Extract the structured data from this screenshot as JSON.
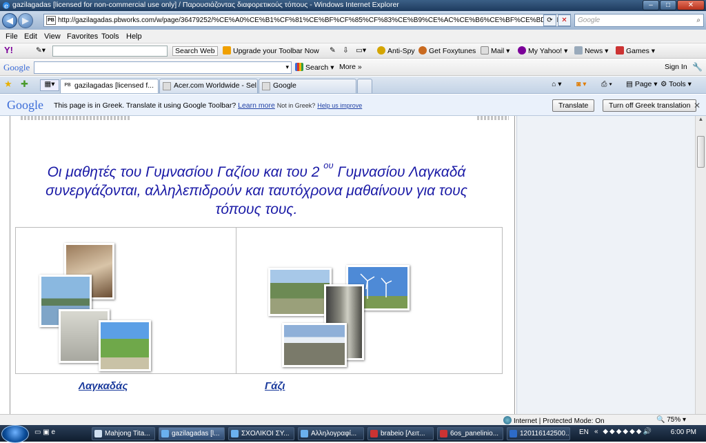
{
  "window": {
    "title": "gazilagadas [licensed for non-commercial use only] / Παρουσιάζοντας διαφορετικούς τόπους - Windows Internet Explorer"
  },
  "address": {
    "url": "http://gazilagadas.pbworks.com/w/page/36479252/%CE%A0%CE%B1%CF%81%CE%BF%CF%85%CF%83%CE%B9%CE%AC%CE%B6%CE%BF%CE%BD%CF%84%C",
    "search_placeholder": "Google"
  },
  "menu": [
    "File",
    "Edit",
    "View",
    "Favorites",
    "Tools",
    "Help"
  ],
  "yahoo": {
    "search_web": "Search Web",
    "upgrade": "Upgrade your Toolbar Now",
    "antispy": "Anti-Spy",
    "foxytunes": "Get Foxytunes",
    "mail": "Mail",
    "myyahoo": "My Yahoo!",
    "news": "News",
    "games": "Games"
  },
  "googlebar": {
    "logo": "Google",
    "search": "Search",
    "more": "More »",
    "signin": "Sign In"
  },
  "tabs": [
    {
      "label": "gazilagadas [licensed f...",
      "icon": "PB"
    },
    {
      "label": "Acer.com Worldwide - Sel..."
    },
    {
      "label": "Google"
    }
  ],
  "commandbar": {
    "page": "Page",
    "tools": "Tools"
  },
  "translate": {
    "logo": "Google",
    "message": "This page is in Greek.  Translate it using Google Toolbar?",
    "learn_more": "Learn more",
    "not_greek": "Not in Greek?",
    "help_improve": "Help us improve",
    "translate_btn": "Translate",
    "turn_off_btn": "Turn off Greek translation"
  },
  "content": {
    "headline_part1": "Οι μαθητές του Γυμνασίου Γαζίου και του 2",
    "headline_sup": "ου",
    "headline_part2": "Γυμνασίου Λαγκαδά",
    "headline_line2": "συνεργάζονται, αλληλεπιδρούν και ταυτόχρονα μαθαίνουν για τους",
    "headline_line3": "τόπους τους.",
    "place_left": "Λαγκαδάς",
    "place_right": "Γάζι"
  },
  "status": {
    "zone": "Internet | Protected Mode: On",
    "zoom": "75%"
  },
  "taskbar": {
    "items": [
      "Mahjong Tita...",
      "gazilagadas [l...",
      "ΣΧΟΛΙΚΟΙ ΣΥ...",
      "Αλληλογραφί...",
      "brabeio [Λειτ...",
      "6os_panelinio...",
      "120116142500..."
    ],
    "lang": "EN",
    "clock": "6:00 PM"
  }
}
